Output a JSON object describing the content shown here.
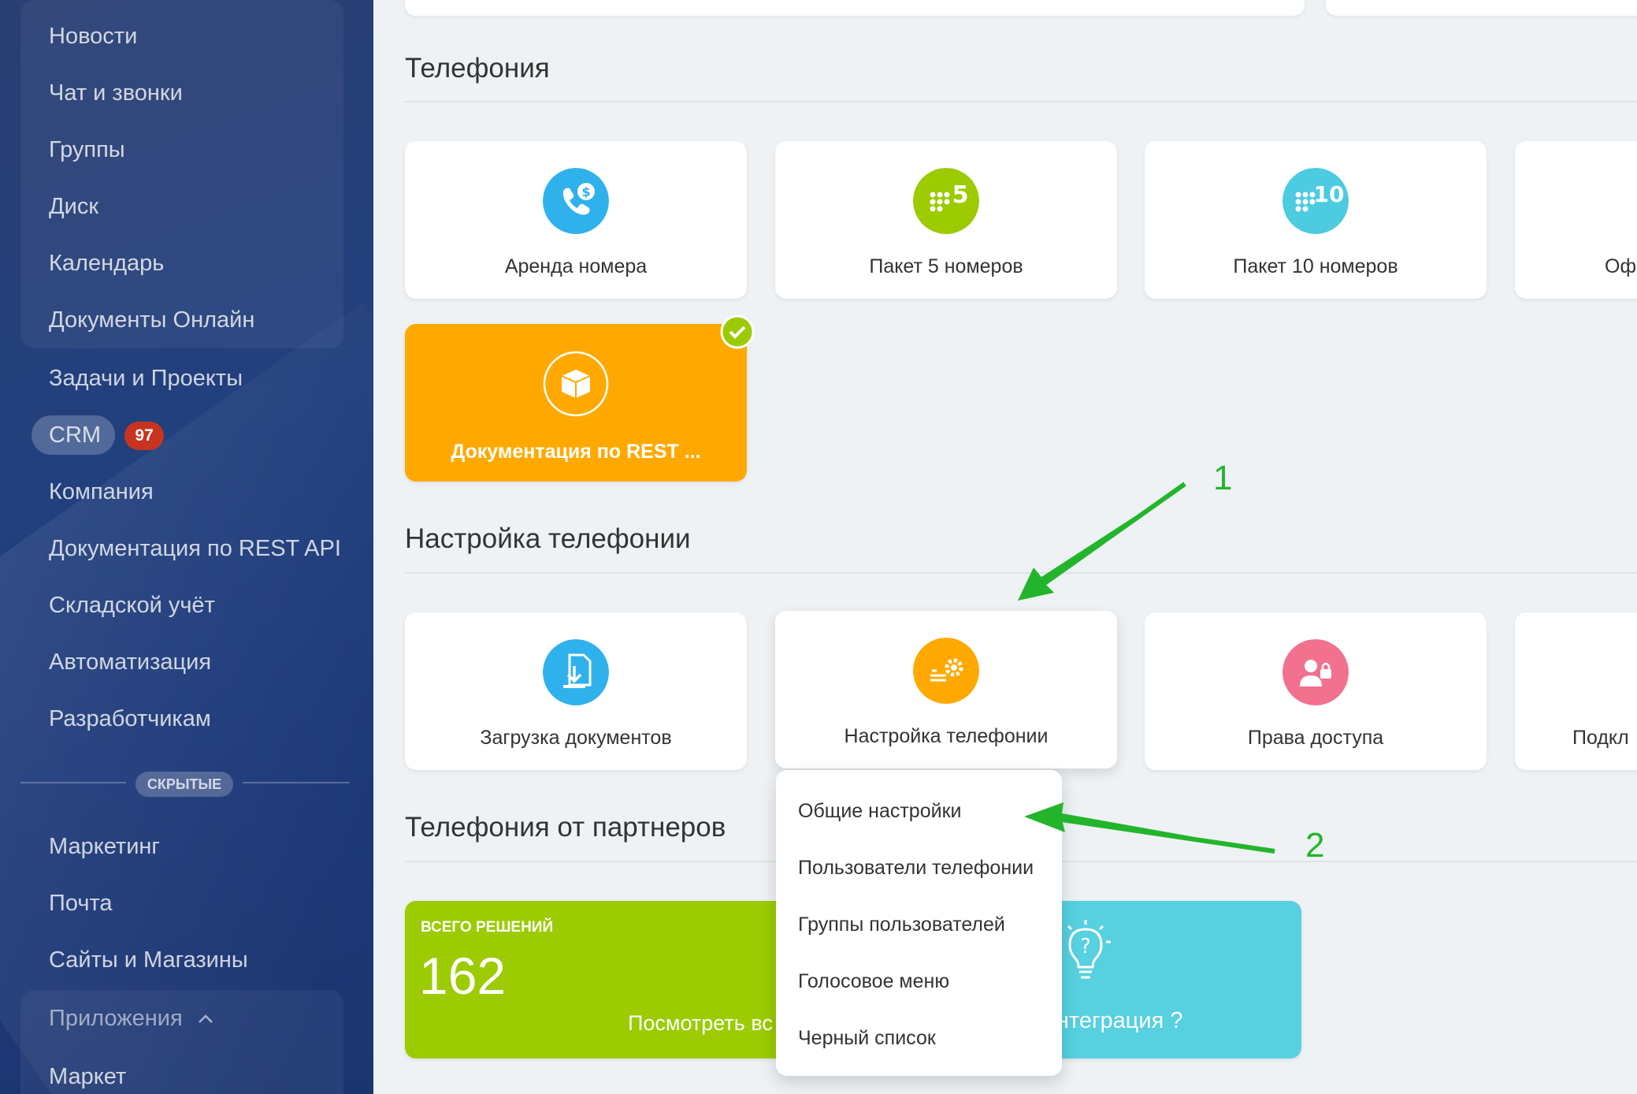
{
  "sidebar": {
    "items": [
      "Новости",
      "Чат и звонки",
      "Группы",
      "Диск",
      "Календарь",
      "Документы Онлайн",
      "Задачи и Проекты",
      "CRM",
      "Компания",
      "Документация по REST API",
      "Складской учёт",
      "Автоматизация",
      "Разработчикам"
    ],
    "crm_badge": "97",
    "hidden_label": "СКРЫТЫЕ",
    "hidden_items": [
      "Маркетинг",
      "Почта",
      "Сайты и Магазины"
    ],
    "apps_label": "Приложения",
    "apps_items": [
      "Маркет"
    ]
  },
  "sections": {
    "telephony": "Телефония",
    "settings": "Настройка телефонии",
    "partners": "Телефония от партнеров"
  },
  "telephony_tiles": [
    "Аренда номера",
    "Пакет 5 номеров",
    "Пакет 10 номеров",
    "Оф"
  ],
  "rest_tile": "Документация по REST ...",
  "icon_text": {
    "pack5": "5",
    "pack10": "10"
  },
  "settings_tiles": [
    "Загрузка документов",
    "Настройка телефонии",
    "Права доступа",
    "Подкл"
  ],
  "partners": {
    "total_label": "ВСЕГО РЕШЕНИЙ",
    "total_value": "162",
    "view_all": "Посмотреть вс",
    "integration": "Интеграция ?"
  },
  "dropdown": [
    "Общие настройки",
    "Пользователи телефонии",
    "Группы пользователей",
    "Голосовое меню",
    "Черный список"
  ],
  "annotations": [
    "1",
    "2"
  ],
  "colors": {
    "blue": "#2fb2eb",
    "green": "#9bcb00",
    "teal": "#4ccbe1",
    "orange": "#ffa900",
    "pink": "#f2718f",
    "arrow": "#22b52c"
  }
}
